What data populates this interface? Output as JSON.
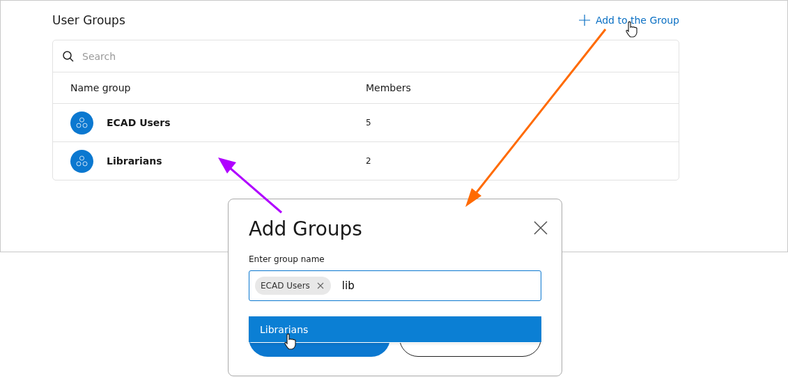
{
  "page": {
    "title": "User Groups",
    "add_link": "Add to the Group"
  },
  "table": {
    "search": {
      "placeholder": "Search"
    },
    "columns": [
      "Name group",
      "Members"
    ],
    "rows": [
      {
        "name": "ECAD Users",
        "members": "5"
      },
      {
        "name": "Librarians",
        "members": "2"
      }
    ]
  },
  "dialog": {
    "title": "Add Groups",
    "field_label": "Enter group name",
    "chips": [
      {
        "label": "ECAD Users"
      }
    ],
    "value": "lib",
    "options": [
      {
        "label": "Librarians",
        "selected": true
      }
    ]
  }
}
